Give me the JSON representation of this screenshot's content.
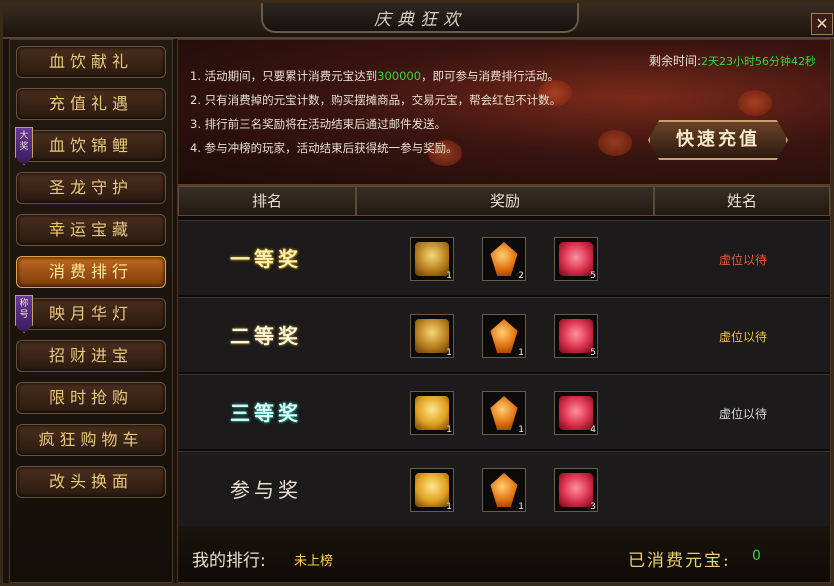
{
  "window": {
    "title": "庆典狂欢",
    "close_label": "✕"
  },
  "sidebar": {
    "items": [
      {
        "label": "血饮献礼",
        "badge": ""
      },
      {
        "label": "充值礼遇",
        "badge": ""
      },
      {
        "label": "血饮锦鲤",
        "badge": "大奖"
      },
      {
        "label": "圣龙守护",
        "badge": ""
      },
      {
        "label": "幸运宝藏",
        "badge": ""
      },
      {
        "label": "消费排行",
        "badge": "",
        "active": true
      },
      {
        "label": "映月华灯",
        "badge": "称号"
      },
      {
        "label": "招财进宝",
        "badge": ""
      },
      {
        "label": "限时抢购",
        "badge": ""
      },
      {
        "label": "疯狂购物车",
        "badge": ""
      },
      {
        "label": "改头换面",
        "badge": ""
      }
    ]
  },
  "banner": {
    "rules": [
      {
        "prefix": "1. 活动期间，只要累计消费元宝达到",
        "highlight": "300000",
        "suffix": "，即可参与消费排行活动。"
      },
      {
        "prefix": "2. 只有消费掉的元宝计数，购买摆摊商品，交易元宝，帮会红包不计数。",
        "highlight": "",
        "suffix": ""
      },
      {
        "prefix": "3. 排行前三名奖励将在活动结束后通过邮件发送。",
        "highlight": "",
        "suffix": ""
      },
      {
        "prefix": "4. 参与冲榜的玩家，活动结束后获得统一参与奖励。",
        "highlight": "",
        "suffix": ""
      }
    ],
    "countdown_label": "剩余时间:",
    "countdown_value": "2天23小时56分钟42秒",
    "recharge_button": "快速充值"
  },
  "table": {
    "headers": {
      "rank": "排名",
      "reward": "奖励",
      "name": "姓名"
    },
    "rows": [
      {
        "rank": "一等奖",
        "rewards": [
          {
            "icon": "treasure-chest-icon",
            "count": "1"
          },
          {
            "icon": "amber-gem-icon",
            "count": "2"
          },
          {
            "icon": "red-rose-icon",
            "count": "5"
          }
        ],
        "winner": "虚位以待",
        "winner_color": "#e85a3a"
      },
      {
        "rank": "二等奖",
        "rewards": [
          {
            "icon": "treasure-chest-icon",
            "count": "1"
          },
          {
            "icon": "amber-gem-icon",
            "count": "1"
          },
          {
            "icon": "red-rose-icon",
            "count": "5"
          }
        ],
        "winner": "虚位以待",
        "winner_color": "#f0c040"
      },
      {
        "rank": "三等奖",
        "rewards": [
          {
            "icon": "golden-chest-icon",
            "count": "1"
          },
          {
            "icon": "amber-gem-icon",
            "count": "1"
          },
          {
            "icon": "red-rose-icon",
            "count": "4"
          }
        ],
        "winner": "虚位以待",
        "winner_color": "#d8d8d8"
      },
      {
        "rank": "参与奖",
        "rewards": [
          {
            "icon": "golden-chest-icon",
            "count": "1"
          },
          {
            "icon": "amber-gem-icon",
            "count": "1"
          },
          {
            "icon": "red-rose-icon",
            "count": "3"
          }
        ],
        "winner": "",
        "winner_color": "#d8d8d8"
      }
    ]
  },
  "footer": {
    "my_rank_label": "我的排行:",
    "my_rank_value": "未上榜",
    "spent_label": "已消费元宝:",
    "spent_value": "0"
  }
}
